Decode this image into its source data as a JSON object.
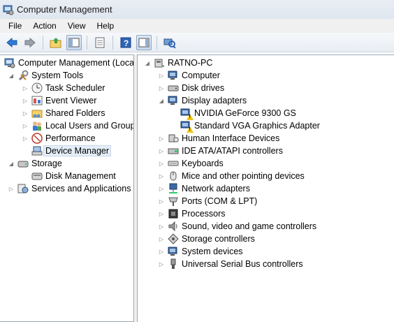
{
  "window": {
    "title": "Computer Management"
  },
  "menu": {
    "file": "File",
    "action": "Action",
    "view": "View",
    "help": "Help"
  },
  "toolbar": {
    "icons": [
      "back-arrow-icon",
      "forward-arrow-icon",
      "up-folder-icon",
      "show-hide-tree-icon",
      "properties-icon",
      "help-icon",
      "action-pane-icon",
      "scan-hardware-icon"
    ]
  },
  "tree": {
    "root": "Computer Management (Local",
    "system_tools": "System Tools",
    "task_scheduler": "Task Scheduler",
    "event_viewer": "Event Viewer",
    "shared_folders": "Shared Folders",
    "local_users": "Local Users and Groups",
    "performance": "Performance",
    "device_manager": "Device Manager",
    "storage": "Storage",
    "disk_management": "Disk Management",
    "services": "Services and Applications"
  },
  "devices": {
    "root": "RATNO-PC",
    "computer": "Computer",
    "disk_drives": "Disk drives",
    "display_adapters": "Display adapters",
    "nvidia": "NVIDIA GeForce 9300 GS",
    "vga": "Standard VGA Graphics Adapter",
    "hid": "Human Interface Devices",
    "ide": "IDE ATA/ATAPI controllers",
    "keyboards": "Keyboards",
    "mice": "Mice and other pointing devices",
    "network": "Network adapters",
    "ports": "Ports (COM & LPT)",
    "processors": "Processors",
    "sound": "Sound, video and game controllers",
    "storage_ctrl": "Storage controllers",
    "system_devices": "System devices",
    "usb": "Universal Serial Bus controllers"
  },
  "colors": {
    "accent": "#1a6fc9",
    "warning": "#f1c40f",
    "selection": "#e5eef8"
  }
}
